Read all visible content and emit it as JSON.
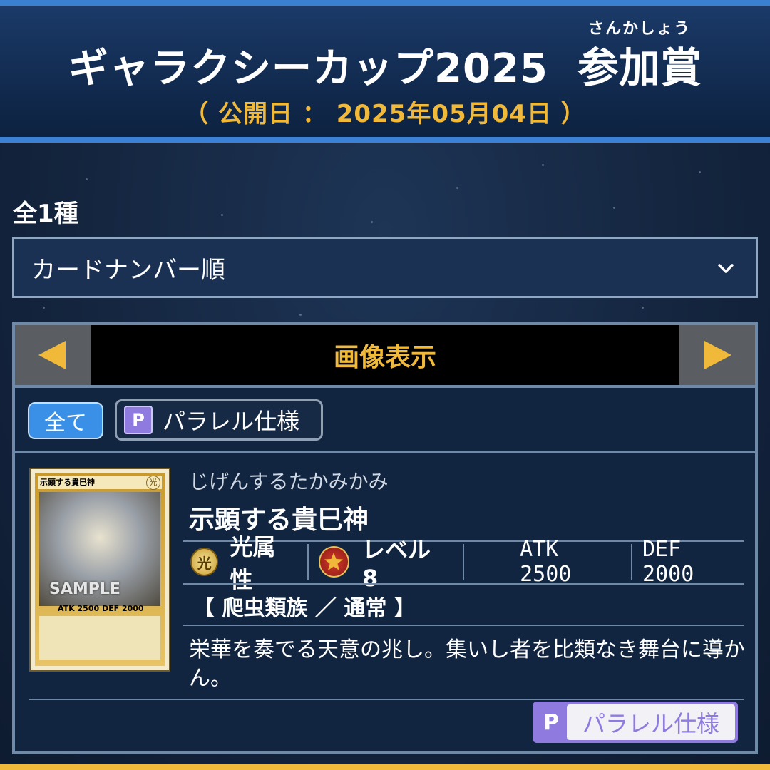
{
  "header": {
    "title": "ギャラクシーカップ2025",
    "prize_ruby": "さんかしょう",
    "prize": "参加賞",
    "release_date": "（ 公開日 ： 2025年05月04日 ）"
  },
  "count_label": "全1種",
  "sort": {
    "selected": "カードナンバー順"
  },
  "view_tab": {
    "title": "画像表示"
  },
  "filters": {
    "all_label": "全て",
    "parallel_badge": "P",
    "parallel_label": "パラレル仕様"
  },
  "card": {
    "image_name": "示顕する貴巳神",
    "image_attr": "光",
    "image_sample": "SAMPLE",
    "image_stats": "ATK 2500 DEF 2000",
    "ruby": "じげんするたかみかみ",
    "name": "示顕する貴巳神",
    "attribute_icon": "光",
    "attribute": "光属性",
    "level": "レベル 8",
    "atk": "ATK 2500",
    "def": "DEF 2000",
    "type": "【 爬虫類族 ／ 通常 】",
    "flavor_text": "栄華を奏でる天意の兆し。集いし者を比類なき舞台に導かん。",
    "rarity_badge": "P",
    "rarity_label": "パラレル仕様"
  },
  "colors": {
    "accent_gold": "#f0b93a",
    "accent_blue": "#3b82d6",
    "parallel_purple": "#8f7be0"
  }
}
